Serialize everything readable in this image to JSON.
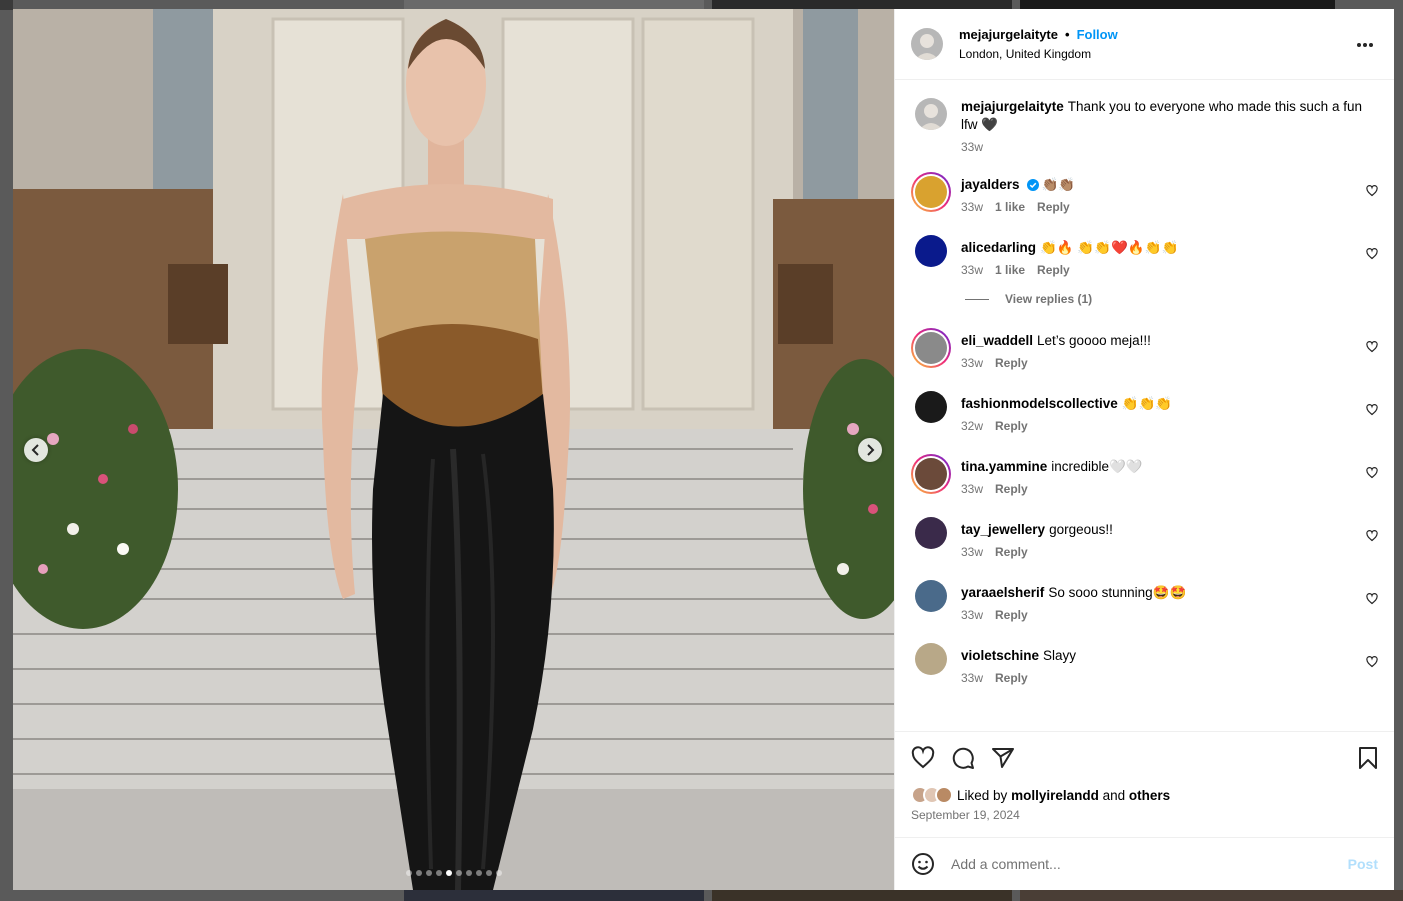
{
  "colors": {
    "accent": "#0095f6",
    "muted": "#737373",
    "post_disabled": "#b2dffc"
  },
  "post": {
    "author": {
      "username": "mejajurgelaityte",
      "follow_label": "Follow",
      "separator": "•",
      "location": "London, United Kingdom"
    },
    "caption": {
      "username": "mejajurgelaityte",
      "text": "Thank you to everyone who made this such a fun lfw 🖤",
      "time": "33w"
    },
    "carousel": {
      "total_slides": 10,
      "active_index": 4
    },
    "comments": [
      {
        "username": "jayalders",
        "verified": true,
        "text": "👏🏽👏🏽",
        "time": "33w",
        "likes": "1 like",
        "reply": "Reply",
        "ring": true,
        "avatar_color": "#d9a22f"
      },
      {
        "username": "alicedarling",
        "text": "👏🔥 👏👏❤️🔥👏👏",
        "time": "33w",
        "likes": "1 like",
        "reply": "Reply",
        "ring": false,
        "avatar_color": "#0a1a8c"
      },
      {
        "username": "eli_waddell",
        "text": "Let’s goooo meja!!!",
        "time": "33w",
        "reply": "Reply",
        "ring": true,
        "avatar_color": "#8a8a8a"
      },
      {
        "username": "fashionmodelscollective",
        "text": "👏👏👏",
        "time": "32w",
        "reply": "Reply",
        "ring": false,
        "avatar_color": "#1a1a1a"
      },
      {
        "username": "tina.yammine",
        "text": "incredible🤍🤍",
        "time": "33w",
        "reply": "Reply",
        "ring": true,
        "avatar_color": "#6b4a3a"
      },
      {
        "username": "tay_jewellery",
        "text": "gorgeous!!",
        "time": "33w",
        "reply": "Reply",
        "ring": false,
        "avatar_color": "#3a2a4a"
      },
      {
        "username": "yaraaelsherif",
        "text": "So sooo stunning🤩🤩",
        "time": "33w",
        "reply": "Reply",
        "ring": false,
        "avatar_color": "#4a6a8a"
      },
      {
        "username": "violetschine",
        "text": "Slayy",
        "time": "33w",
        "reply": "Reply",
        "ring": false,
        "avatar_color": "#b8a888"
      }
    ],
    "view_replies": "View replies (1)",
    "liked_by": {
      "prefix": "Liked by",
      "user": "mollyirelandd",
      "conj": "and",
      "others": "others"
    },
    "date": "September 19, 2024",
    "add_comment_placeholder": "Add a comment...",
    "post_label": "Post"
  },
  "icons": {
    "more": "more-horizontal-icon",
    "like": "heart-icon",
    "comment": "comment-icon",
    "share": "share-icon",
    "save": "bookmark-icon",
    "emoji": "emoji-icon",
    "prev": "chevron-left-icon",
    "next": "chevron-right-icon",
    "verified": "verified-badge-icon"
  }
}
